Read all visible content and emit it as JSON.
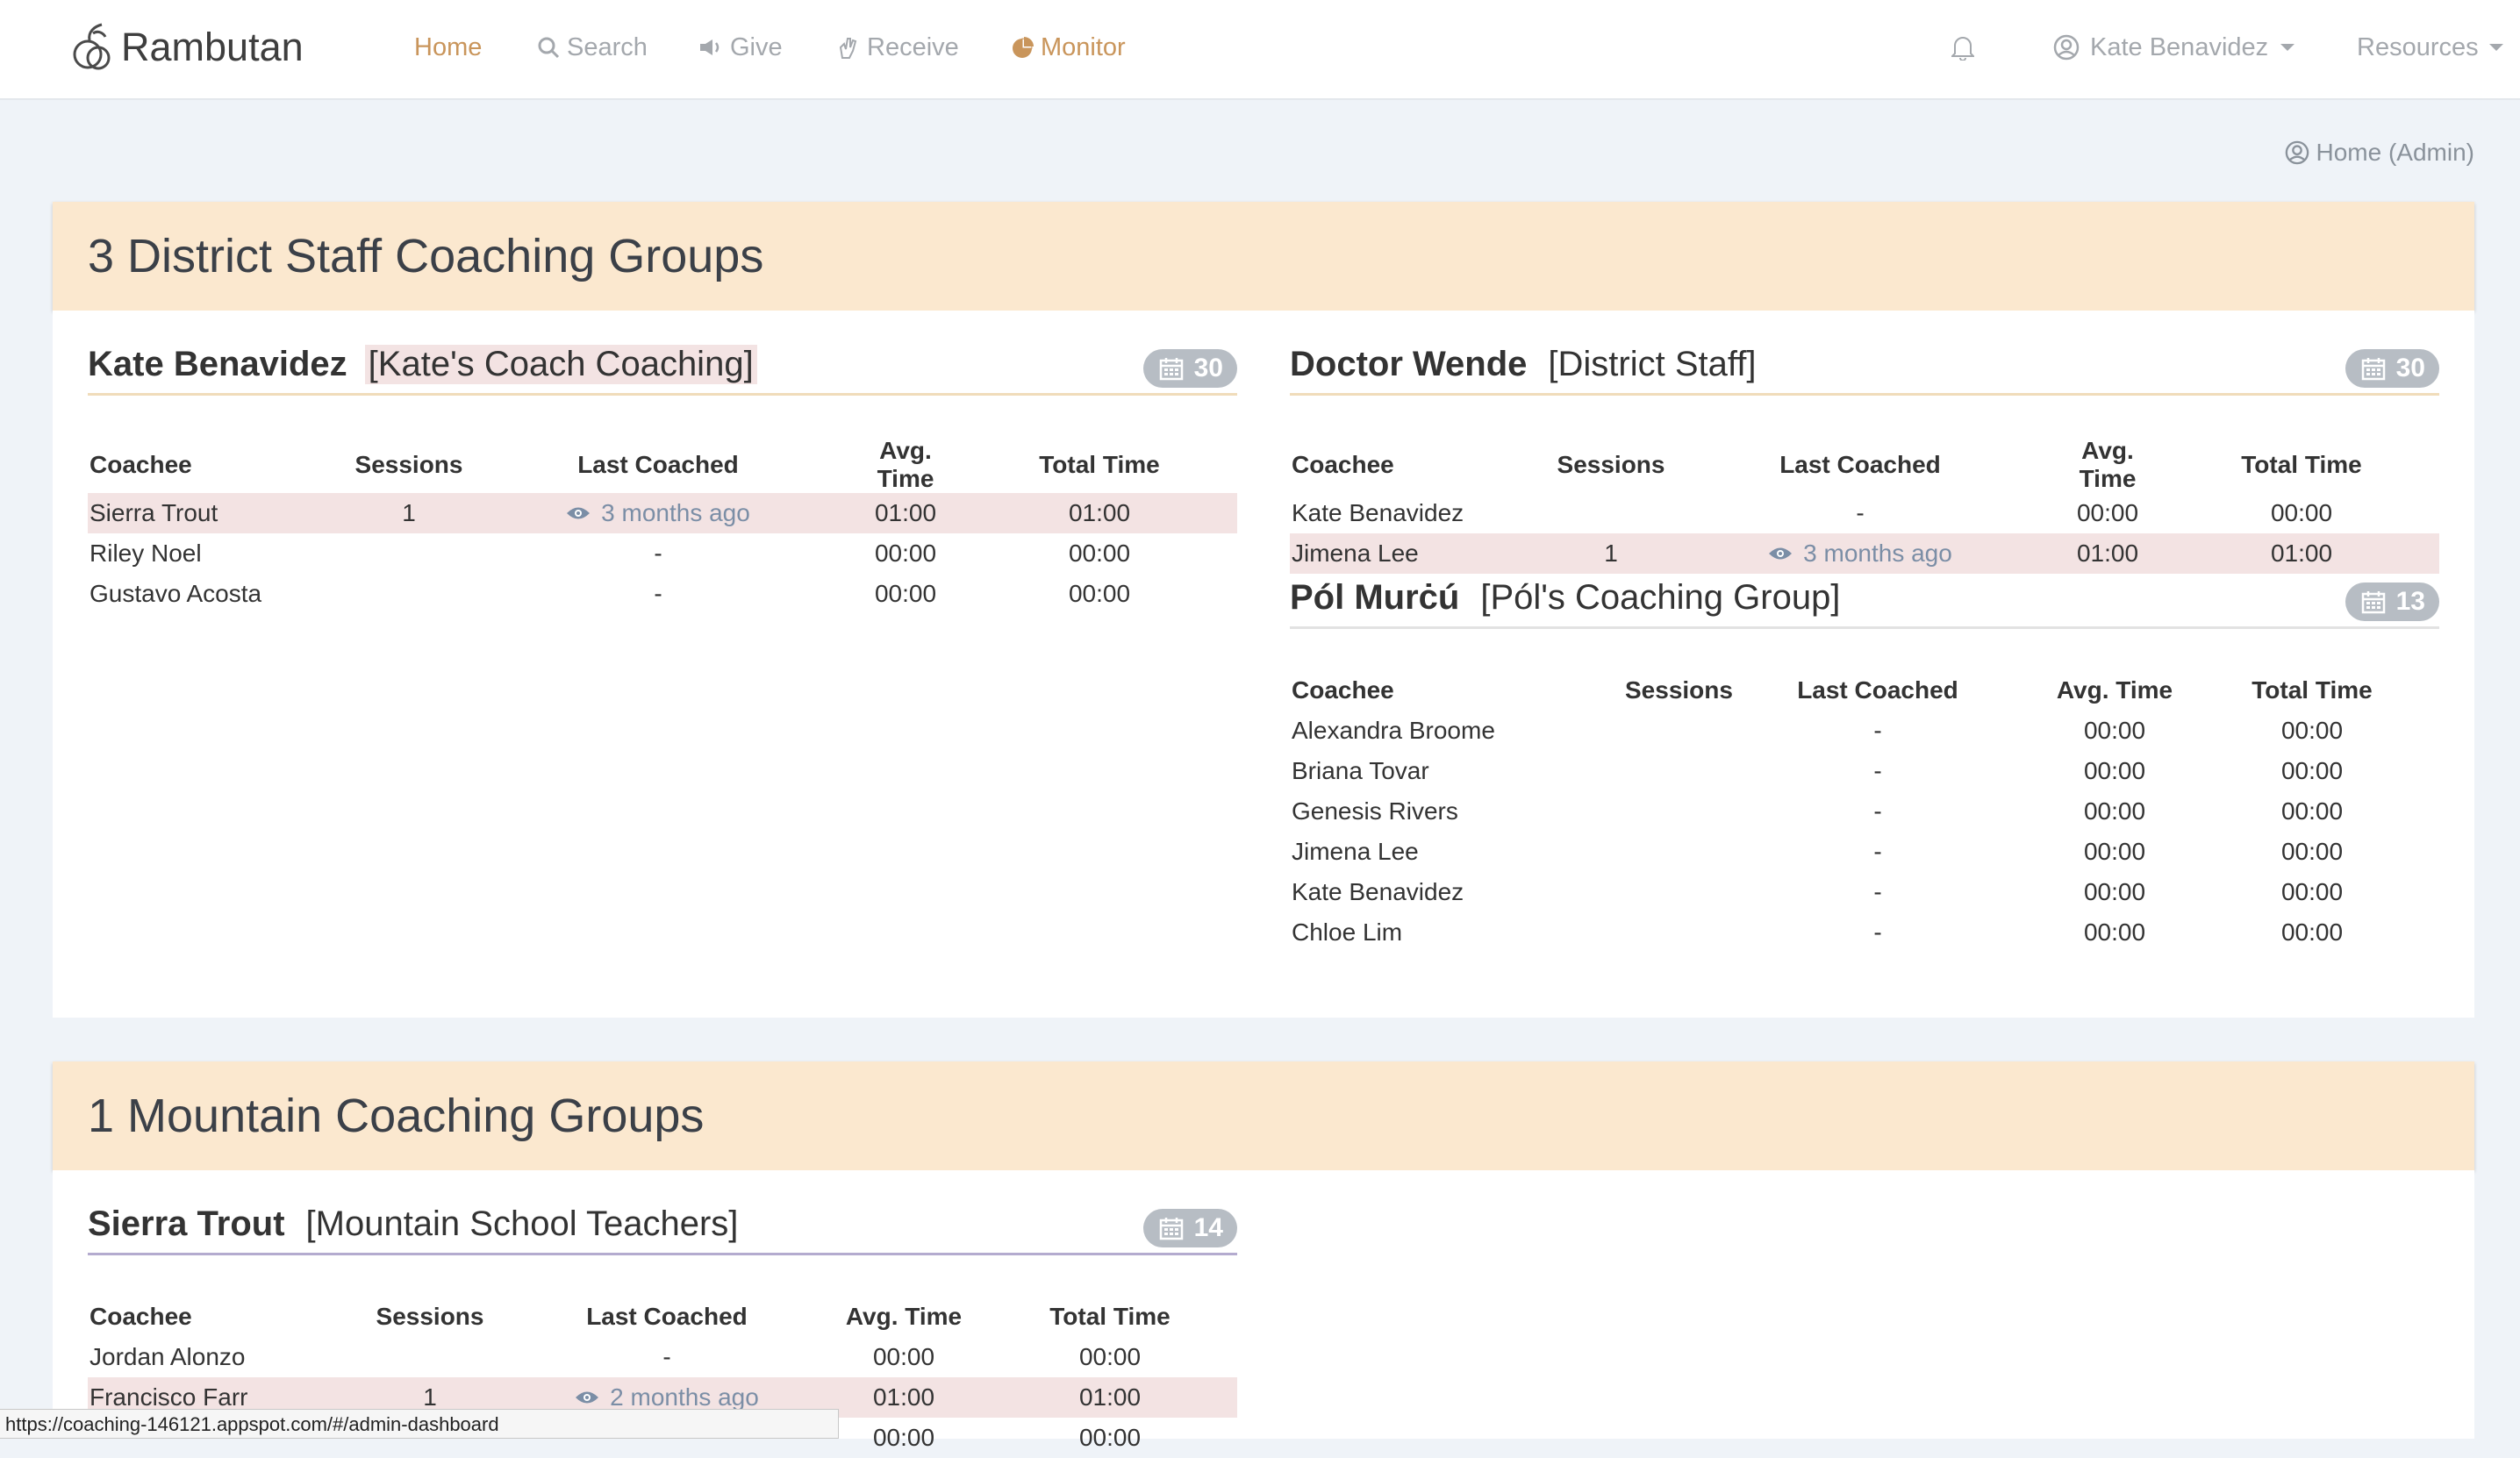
{
  "nav": {
    "brand": "Rambutan",
    "items": [
      {
        "label": "Home",
        "icon": "home",
        "active": true
      },
      {
        "label": "Search",
        "icon": "search-icon",
        "active": false
      },
      {
        "label": "Give",
        "icon": "megaphone-icon",
        "active": false
      },
      {
        "label": "Receive",
        "icon": "hand-icon",
        "active": false
      },
      {
        "label": "Monitor",
        "icon": "pie-chart-icon",
        "active": true
      }
    ],
    "user": "Kate Benavidez",
    "resources": "Resources"
  },
  "admin_link": "Home (Admin)",
  "colors": {
    "accent": "#c9955b",
    "header_bg": "#fbe8cf",
    "highlight_row": "#f3e3e3",
    "badge": "#b7bdc4"
  },
  "table_headers": [
    "Coachee",
    "Sessions",
    "Last Coached",
    "Avg. Time",
    "Total Time"
  ],
  "sections": [
    {
      "title": "3 District Staff Coaching Groups",
      "groups": [
        {
          "coach": "Kate Benavidez",
          "group_name": "[Kate's Coach Coaching]",
          "badge": "30",
          "rows": [
            {
              "coachee": "Sierra Trout",
              "sessions": "1",
              "last": "3 months ago",
              "avg": "01:00",
              "total": "01:00",
              "highlight": true
            },
            {
              "coachee": "Riley Noel",
              "sessions": "",
              "last": "-",
              "avg": "00:00",
              "total": "00:00",
              "highlight": false
            },
            {
              "coachee": "Gustavo Acosta",
              "sessions": "",
              "last": "-",
              "avg": "00:00",
              "total": "00:00",
              "highlight": false
            }
          ]
        },
        {
          "coach": "Doctor Wende",
          "group_name": "[District Staff]",
          "badge": "30",
          "rows": [
            {
              "coachee": "Kate Benavidez",
              "sessions": "",
              "last": "-",
              "avg": "00:00",
              "total": "00:00",
              "highlight": false
            },
            {
              "coachee": "Jimena Lee",
              "sessions": "1",
              "last": "3 months ago",
              "avg": "01:00",
              "total": "01:00",
              "highlight": true
            }
          ]
        },
        {
          "coach": "Pól Murċú",
          "group_name": "[Pól's Coaching Group]",
          "badge": "13",
          "rows": [
            {
              "coachee": "Alexandra Broome",
              "sessions": "",
              "last": "-",
              "avg": "00:00",
              "total": "00:00",
              "highlight": false
            },
            {
              "coachee": "Briana Tovar",
              "sessions": "",
              "last": "-",
              "avg": "00:00",
              "total": "00:00",
              "highlight": false
            },
            {
              "coachee": "Genesis Rivers",
              "sessions": "",
              "last": "-",
              "avg": "00:00",
              "total": "00:00",
              "highlight": false
            },
            {
              "coachee": "Jimena Lee",
              "sessions": "",
              "last": "-",
              "avg": "00:00",
              "total": "00:00",
              "highlight": false
            },
            {
              "coachee": "Kate Benavidez",
              "sessions": "",
              "last": "-",
              "avg": "00:00",
              "total": "00:00",
              "highlight": false
            },
            {
              "coachee": "Chloe Lim",
              "sessions": "",
              "last": "-",
              "avg": "00:00",
              "total": "00:00",
              "highlight": false
            }
          ]
        }
      ]
    },
    {
      "title": "1 Mountain Coaching Groups",
      "groups": [
        {
          "coach": "Sierra Trout",
          "group_name": "[Mountain School Teachers]",
          "badge": "14",
          "rows": [
            {
              "coachee": "Jordan Alonzo",
              "sessions": "",
              "last": "-",
              "avg": "00:00",
              "total": "00:00",
              "highlight": false
            },
            {
              "coachee": "Francisco Farr",
              "sessions": "1",
              "last": "2 months ago",
              "avg": "01:00",
              "total": "01:00",
              "highlight": true
            },
            {
              "coachee": "",
              "sessions": "",
              "last": "",
              "avg": "00:00",
              "total": "00:00",
              "highlight": false
            }
          ]
        }
      ]
    }
  ],
  "status_url": "https://coaching-146121.appspot.com/#/admin-dashboard"
}
